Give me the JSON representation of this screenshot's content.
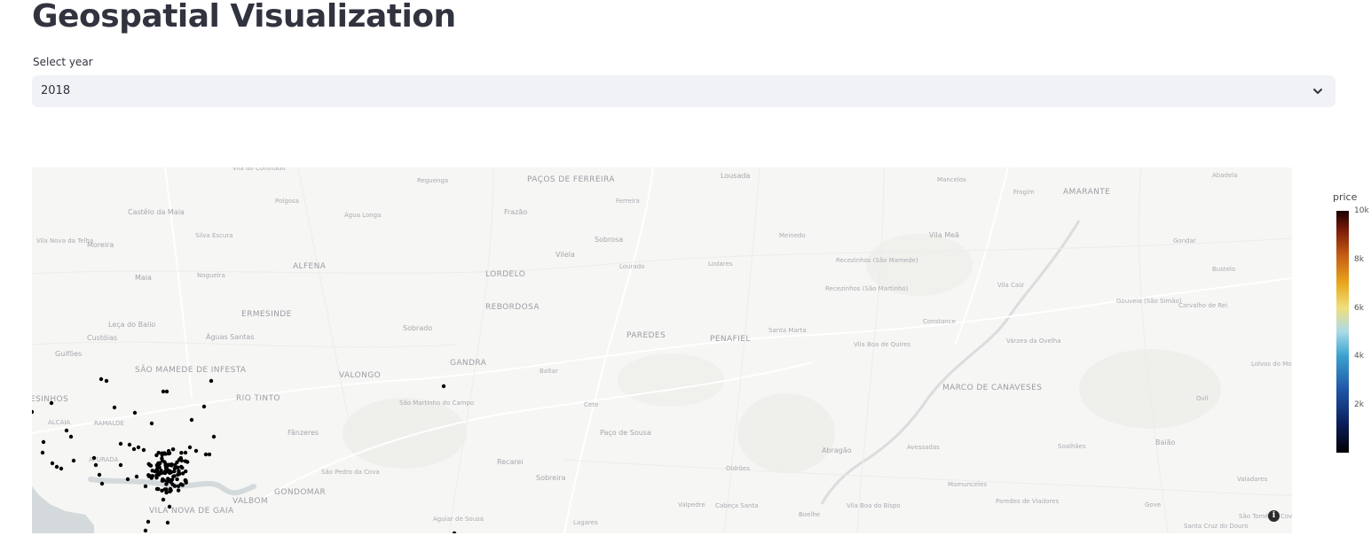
{
  "page": {
    "title": "Geospatial Visualization"
  },
  "year_select": {
    "label": "Select year",
    "value": "2018"
  },
  "colorbar": {
    "title": "price",
    "ticks": [
      "10k",
      "8k",
      "6k",
      "4k",
      "2k"
    ]
  },
  "map": {
    "point_color": "#000000",
    "land_color": "#f6f6f4",
    "water_color": "#d4dadc",
    "places": [
      {
        "name": "Vila do Coronado",
        "cls": "",
        "l": 226,
        "t": -2
      },
      {
        "name": "Reguenga",
        "cls": "",
        "l": 434,
        "t": 12
      },
      {
        "name": "PAÇOS DE FERREIRA",
        "cls": "big",
        "l": 558,
        "t": 10
      },
      {
        "name": "Lousada",
        "cls": "mid",
        "l": 776,
        "t": 6
      },
      {
        "name": "Mancelos",
        "cls": "",
        "l": 1020,
        "t": 11
      },
      {
        "name": "Abadela",
        "cls": "",
        "l": 1330,
        "t": 6
      },
      {
        "name": "Frogim",
        "cls": "",
        "l": 1106,
        "t": 25
      },
      {
        "name": "AMARANTE",
        "cls": "big",
        "l": 1162,
        "t": 24
      },
      {
        "name": "Ferreira",
        "cls": "",
        "l": 658,
        "t": 35
      },
      {
        "name": "Polgosa",
        "cls": "",
        "l": 274,
        "t": 35
      },
      {
        "name": "Castêlo da Maia",
        "cls": "mid",
        "l": 108,
        "t": 47
      },
      {
        "name": "Água Longa",
        "cls": "",
        "l": 352,
        "t": 51
      },
      {
        "name": "Frazão",
        "cls": "mid",
        "l": 532,
        "t": 47
      },
      {
        "name": "Sobrosa",
        "cls": "mid",
        "l": 634,
        "t": 78
      },
      {
        "name": "Meinedo",
        "cls": "",
        "l": 842,
        "t": 74
      },
      {
        "name": "Vila Meã",
        "cls": "mid",
        "l": 1011,
        "t": 73
      },
      {
        "name": "Gondar",
        "cls": "",
        "l": 1286,
        "t": 80
      },
      {
        "name": "Silva Escura",
        "cls": "",
        "l": 184,
        "t": 74
      },
      {
        "name": "Vila Nova da Telha",
        "cls": "",
        "l": 5,
        "t": 80
      },
      {
        "name": "Moreira",
        "cls": "mid",
        "l": 62,
        "t": 84
      },
      {
        "name": "Vilela",
        "cls": "mid",
        "l": 590,
        "t": 95
      },
      {
        "name": "Lourado",
        "cls": "",
        "l": 662,
        "t": 109
      },
      {
        "name": "Lodares",
        "cls": "",
        "l": 762,
        "t": 106
      },
      {
        "name": "Recezinhos (São Mamede)",
        "cls": "",
        "l": 906,
        "t": 102
      },
      {
        "name": "Bustelo",
        "cls": "",
        "l": 1330,
        "t": 112
      },
      {
        "name": "ALFENA",
        "cls": "big",
        "l": 294,
        "t": 108
      },
      {
        "name": "Nogueira",
        "cls": "",
        "l": 186,
        "t": 119
      },
      {
        "name": "Maia",
        "cls": "mid",
        "l": 116,
        "t": 121
      },
      {
        "name": "LORDELO",
        "cls": "big",
        "l": 511,
        "t": 117
      },
      {
        "name": "Vila Caiz",
        "cls": "",
        "l": 1088,
        "t": 130
      },
      {
        "name": "Recezinhos (São Martinho)",
        "cls": "",
        "l": 894,
        "t": 134
      },
      {
        "name": "Gouveia (São Simão)",
        "cls": "",
        "l": 1222,
        "t": 148
      },
      {
        "name": "Carvalho de Rei",
        "cls": "",
        "l": 1292,
        "t": 153
      },
      {
        "name": "REBORDOSA",
        "cls": "big",
        "l": 511,
        "t": 154
      },
      {
        "name": "ERMESINDE",
        "cls": "big",
        "l": 236,
        "t": 162
      },
      {
        "name": "Leça do Balio",
        "cls": "mid",
        "l": 86,
        "t": 174
      },
      {
        "name": "Sobrado",
        "cls": "mid",
        "l": 418,
        "t": 178
      },
      {
        "name": "Santa Marta",
        "cls": "",
        "l": 830,
        "t": 181
      },
      {
        "name": "Constance",
        "cls": "",
        "l": 1004,
        "t": 171
      },
      {
        "name": "Custóias",
        "cls": "mid",
        "l": 62,
        "t": 189
      },
      {
        "name": "Águas Santas",
        "cls": "mid",
        "l": 196,
        "t": 188
      },
      {
        "name": "PAREDES",
        "cls": "big",
        "l": 670,
        "t": 186
      },
      {
        "name": "PENAFIEL",
        "cls": "big",
        "l": 764,
        "t": 190
      },
      {
        "name": "Vila Boa de Quires",
        "cls": "",
        "l": 926,
        "t": 197
      },
      {
        "name": "Várzea da Ovelha",
        "cls": "",
        "l": 1098,
        "t": 193
      },
      {
        "name": "Guifões",
        "cls": "mid",
        "l": 26,
        "t": 207
      },
      {
        "name": "GANDRA",
        "cls": "big",
        "l": 471,
        "t": 217
      },
      {
        "name": "Lolvos do Monte",
        "cls": "",
        "l": 1374,
        "t": 219
      },
      {
        "name": "Baltar",
        "cls": "",
        "l": 572,
        "t": 227
      },
      {
        "name": "SÃO MAMEDE DE INFESTA",
        "cls": "big",
        "l": 116,
        "t": 225
      },
      {
        "name": "VALONGO",
        "cls": "big",
        "l": 346,
        "t": 231
      },
      {
        "name": "MARCO DE CANAVESES",
        "cls": "big",
        "l": 1026,
        "t": 245
      },
      {
        "name": "ESINHOS",
        "cls": "big",
        "l": -2,
        "t": 258
      },
      {
        "name": "RIO TINTO",
        "cls": "big",
        "l": 230,
        "t": 257
      },
      {
        "name": "São Martinho do Campo",
        "cls": "",
        "l": 414,
        "t": 263
      },
      {
        "name": "Cete",
        "cls": "",
        "l": 622,
        "t": 265
      },
      {
        "name": "Ovil",
        "cls": "",
        "l": 1312,
        "t": 258
      },
      {
        "name": "ALCAIA",
        "cls": "",
        "l": 18,
        "t": 285
      },
      {
        "name": "RAMALDE",
        "cls": "",
        "l": 70,
        "t": 286
      },
      {
        "name": "Fânzeres",
        "cls": "mid",
        "l": 288,
        "t": 296
      },
      {
        "name": "Paço de Sousa",
        "cls": "mid",
        "l": 640,
        "t": 296
      },
      {
        "name": "Baião",
        "cls": "mid",
        "l": 1266,
        "t": 307
      },
      {
        "name": "Avessadas",
        "cls": "",
        "l": 986,
        "t": 313
      },
      {
        "name": "Soalhães",
        "cls": "",
        "l": 1156,
        "t": 312
      },
      {
        "name": "Abragão",
        "cls": "mid",
        "l": 890,
        "t": 316
      },
      {
        "name": "Recarei",
        "cls": "mid",
        "l": 524,
        "t": 329
      },
      {
        "name": "Oldrões",
        "cls": "",
        "l": 782,
        "t": 337
      },
      {
        "name": "São Pedro da Cova",
        "cls": "",
        "l": 326,
        "t": 341
      },
      {
        "name": "Sobreira",
        "cls": "mid",
        "l": 568,
        "t": 347
      },
      {
        "name": "Valadares",
        "cls": "",
        "l": 1358,
        "t": 349
      },
      {
        "name": "Mamunceles",
        "cls": "",
        "l": 1032,
        "t": 355
      },
      {
        "name": "GONDOMAR",
        "cls": "big",
        "l": 273,
        "t": 363
      },
      {
        "name": "VALBOM",
        "cls": "big",
        "l": 226,
        "t": 373
      },
      {
        "name": "Paredes de Viadores",
        "cls": "",
        "l": 1086,
        "t": 374
      },
      {
        "name": "Valpedre",
        "cls": "",
        "l": 728,
        "t": 378
      },
      {
        "name": "Cabeça Santa",
        "cls": "",
        "l": 770,
        "t": 379
      },
      {
        "name": "Boelhe",
        "cls": "",
        "l": 864,
        "t": 389
      },
      {
        "name": "Vila Boa do Bispo",
        "cls": "",
        "l": 918,
        "t": 379
      },
      {
        "name": "Gove",
        "cls": "",
        "l": 1254,
        "t": 378
      },
      {
        "name": "VILA NOVA DE GAIA",
        "cls": "big",
        "l": 132,
        "t": 384
      },
      {
        "name": "Aguiar de Sousa",
        "cls": "",
        "l": 452,
        "t": 394
      },
      {
        "name": "Lagares",
        "cls": "",
        "l": 610,
        "t": 398
      },
      {
        "name": "São Tomé de Covelas",
        "cls": "",
        "l": 1360,
        "t": 391
      },
      {
        "name": "Santa Cruz do Douro",
        "cls": "",
        "l": 1298,
        "t": 402
      },
      {
        "name": "AFURADA",
        "cls": "",
        "l": 64,
        "t": 327
      }
    ]
  }
}
